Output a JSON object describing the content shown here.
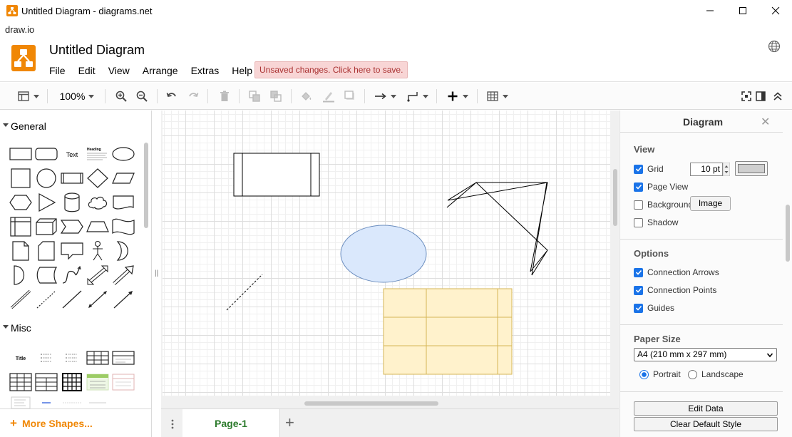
{
  "window": {
    "title": "Untitled Diagram - diagrams.net",
    "address": "draw.io"
  },
  "header": {
    "doc_title": "Untitled Diagram",
    "menu": [
      "File",
      "Edit",
      "View",
      "Arrange",
      "Extras",
      "Help"
    ],
    "unsaved_notice": "Unsaved changes. Click here to save."
  },
  "toolbar": {
    "zoom": "100%"
  },
  "sidebar": {
    "sections": [
      {
        "title": "General"
      },
      {
        "title": "Misc"
      }
    ],
    "general_text_shape": "Text",
    "general_heading_shape": "Heading",
    "misc_title_shape": "Title",
    "more_shapes": "More Shapes..."
  },
  "pages": {
    "tabs": [
      "Page-1"
    ]
  },
  "format_panel": {
    "title": "Diagram",
    "view": {
      "title": "View",
      "grid_label": "Grid",
      "grid_size": "10 pt",
      "grid_checked": true,
      "page_view_label": "Page View",
      "page_view_checked": true,
      "background_label": "Background",
      "background_checked": false,
      "image_button": "Image",
      "shadow_label": "Shadow",
      "shadow_checked": false
    },
    "options": {
      "title": "Options",
      "connection_arrows": "Connection Arrows",
      "connection_points": "Connection Points",
      "guides": "Guides"
    },
    "paper_size": {
      "title": "Paper Size",
      "selected": "A4 (210 mm x 297 mm)",
      "portrait": "Portrait",
      "landscape": "Landscape",
      "orientation": "Portrait"
    },
    "buttons": {
      "edit_data": "Edit Data",
      "clear_default_style": "Clear Default Style"
    }
  },
  "colors": {
    "accent": "#f08705",
    "ellipse_fill": "#dae8fc",
    "ellipse_stroke": "#6c8ebf",
    "table_fill": "#fff2cc",
    "table_stroke": "#d6b656",
    "unsaved_bg": "#f8d5d5",
    "page_tab_text": "#2c7a2c"
  }
}
